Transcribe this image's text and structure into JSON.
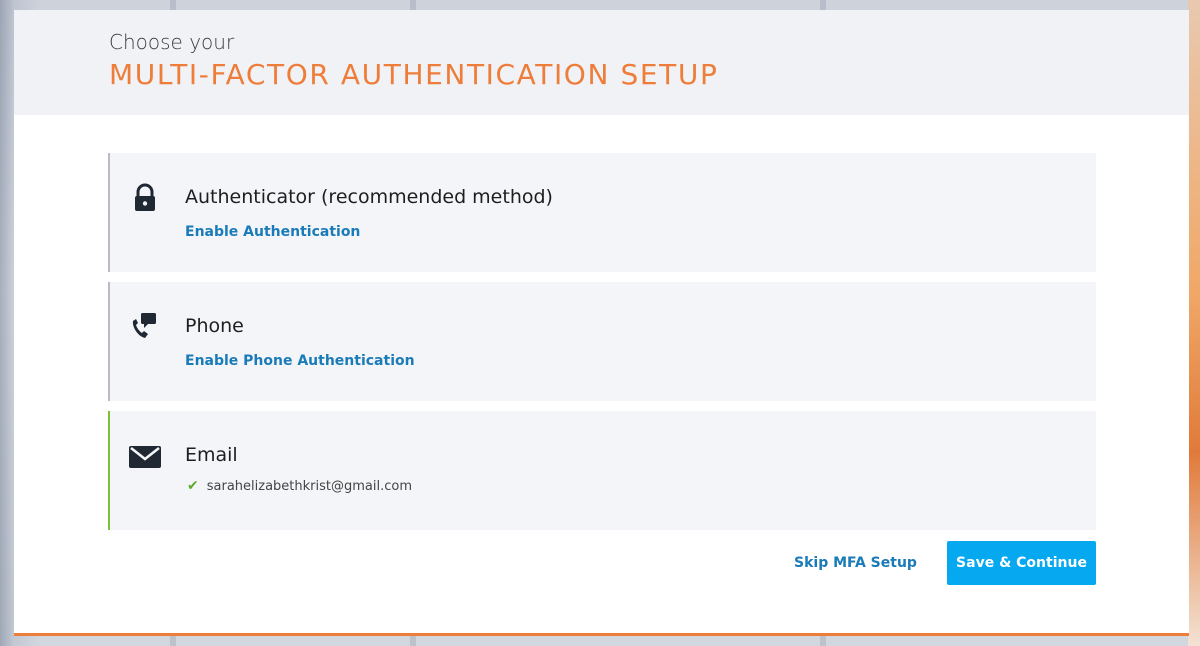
{
  "header": {
    "subtitle": "Choose your",
    "title": "MULTI-FACTOR AUTHENTICATION SETUP"
  },
  "methods": [
    {
      "icon": "lock-icon",
      "title": "Authenticator (recommended method)",
      "link": "Enable Authentication",
      "status": "not-configured"
    },
    {
      "icon": "phone-chat-icon",
      "title": "Phone",
      "link": "Enable Phone Authentication",
      "status": "not-configured"
    },
    {
      "icon": "envelope-icon",
      "title": "Email",
      "email": "sarahelizabethkrist@gmail.com",
      "status": "configured"
    }
  ],
  "actions": {
    "skip_label": "Skip MFA Setup",
    "save_label": "Save & Continue"
  },
  "colors": {
    "accent_orange": "#ef7d3a",
    "link_blue": "#1a7bb8",
    "button_blue": "#06a8ef",
    "success_green": "#7bbf3a"
  }
}
